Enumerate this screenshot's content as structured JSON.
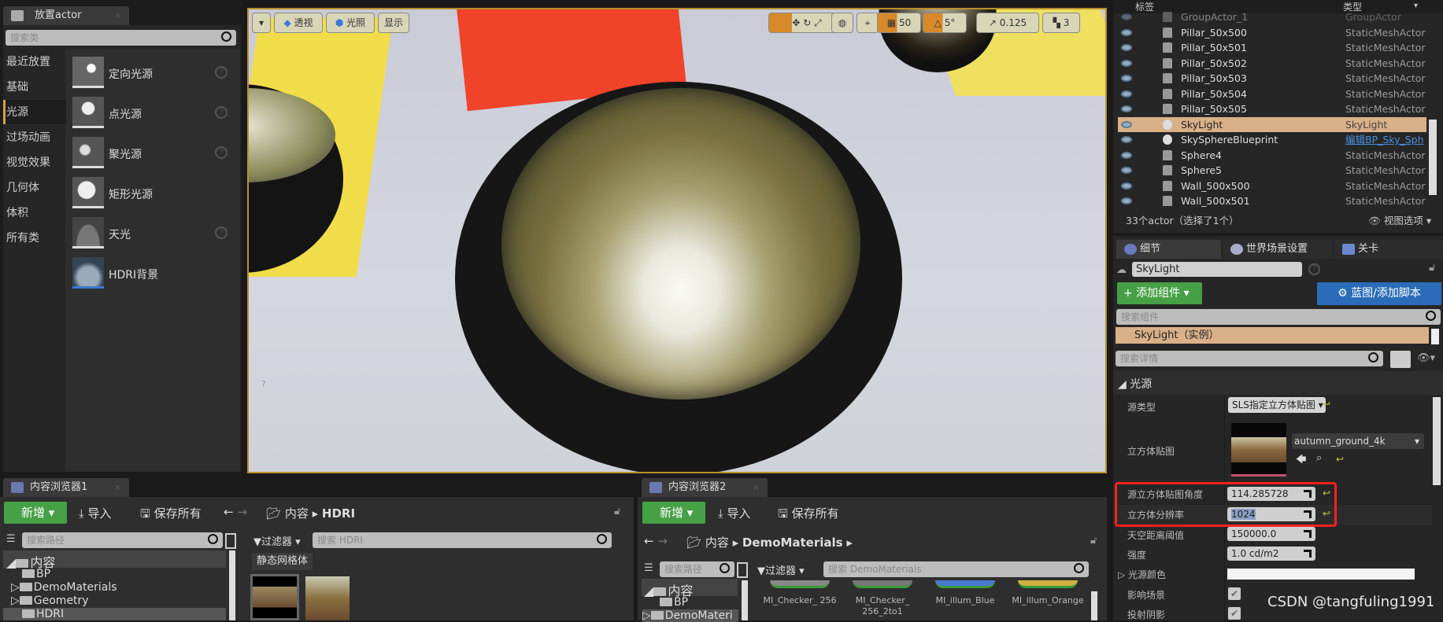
{
  "place_actor": {
    "tab": "放置actor",
    "search_placeholder": "搜索类",
    "categories": [
      "最近放置",
      "基础",
      "光源",
      "过场动画",
      "视觉效果",
      "几何体",
      "体积",
      "所有类"
    ],
    "selected_category": "光源",
    "items": [
      {
        "label": "定向光源",
        "help": true
      },
      {
        "label": "点光源",
        "help": true
      },
      {
        "label": "聚光源",
        "help": true
      },
      {
        "label": "矩形光源",
        "help": false
      },
      {
        "label": "天光",
        "help": true
      },
      {
        "label": "HDRI背景",
        "help": false
      }
    ]
  },
  "viewport": {
    "perspective": "透视",
    "lit": "光照",
    "show": "显示",
    "grid_snap": "50",
    "rot_snap": "5°",
    "scale_snap": "0.125",
    "camera_speed": "3"
  },
  "outliner": {
    "col_label": "标签",
    "col_type": "类型",
    "rows": [
      {
        "name": "GroupActor_1",
        "type": "GroupActor"
      },
      {
        "name": "Pillar_50x500",
        "type": "StaticMeshActor"
      },
      {
        "name": "Pillar_50x501",
        "type": "StaticMeshActor"
      },
      {
        "name": "Pillar_50x502",
        "type": "StaticMeshActor"
      },
      {
        "name": "Pillar_50x503",
        "type": "StaticMeshActor"
      },
      {
        "name": "Pillar_50x504",
        "type": "StaticMeshActor"
      },
      {
        "name": "Pillar_50x505",
        "type": "StaticMeshActor"
      },
      {
        "name": "SkyLight",
        "type": "SkyLight",
        "selected": true
      },
      {
        "name": "SkySphereBlueprint",
        "type": "编辑BP_Sky_Sph",
        "link": true
      },
      {
        "name": "Sphere4",
        "type": "StaticMeshActor"
      },
      {
        "name": "Sphere5",
        "type": "StaticMeshActor"
      },
      {
        "name": "Wall_500x500",
        "type": "StaticMeshActor"
      },
      {
        "name": "Wall_500x501",
        "type": "StaticMeshActor"
      }
    ],
    "footer": "33个actor（选择了1个）",
    "view_options": "视图选项"
  },
  "details": {
    "tabs": [
      "细节",
      "世界场景设置",
      "关卡"
    ],
    "actor_name": "SkyLight",
    "add_component": "添加组件",
    "blueprint": "蓝图/添加脚本",
    "search_components": "搜索组件",
    "component": "SkyLight（实例）",
    "search_details": "搜索详情",
    "section": "光源",
    "source_type_label": "源类型",
    "source_type": "SLS指定立方体贴图",
    "cubemap_label": "立方体贴图",
    "cubemap": "autumn_ground_4k",
    "angle_label": "源立方体贴图角度",
    "angle": "114.285728",
    "resolution_label": "立方体分辨率",
    "resolution": "1024",
    "sky_distance_label": "天空距离阈值",
    "sky_distance": "150000.0",
    "intensity_label": "强度",
    "intensity": "1.0 cd/m2",
    "color_label": "光源颜色",
    "affects_world_label": "影响场景",
    "cast_shadows_label": "投射阴影",
    "highlight_color": "#ff2020"
  },
  "cb1": {
    "tab": "内容浏览器1",
    "new": "新增",
    "import": "导入",
    "save_all": "保存所有",
    "path_root": "内容",
    "path_leaf": "HDRI",
    "search_path": "搜索路径",
    "filter": "过滤器",
    "search_assets": "搜索 HDRI",
    "filter_chip": "静态网格体",
    "tree": [
      "内容",
      "BP",
      "DemoMaterials",
      "Geometry",
      "HDRI"
    ]
  },
  "cb2": {
    "tab": "内容浏览器2",
    "new": "新增",
    "import": "导入",
    "save_all": "保存所有",
    "path_root": "内容",
    "path_leaf": "DemoMaterials",
    "search_path": "搜索路径",
    "filter": "过滤器",
    "search_assets": "搜索 DemoMaterials",
    "tree": [
      "内容",
      "BP",
      "DemoMateri"
    ],
    "assets": [
      "MI_Checker_ 256",
      "MI_Checker_ 256_2to1",
      "MI_illum_Blue",
      "MI_illum_Orange"
    ]
  },
  "watermark": "CSDN @tangfuling1991"
}
